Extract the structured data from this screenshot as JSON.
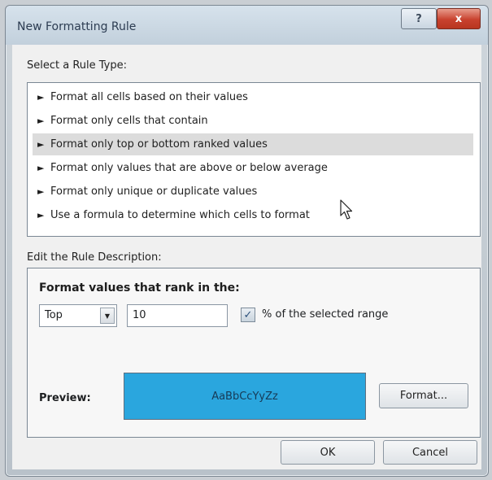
{
  "window": {
    "title": "New Formatting Rule",
    "help_label": "?",
    "close_label": "x"
  },
  "rule_type": {
    "label": "Select a Rule Type:",
    "selected_index": 2,
    "items": [
      "Format all cells based on their values",
      "Format only cells that contain",
      "Format only top or bottom ranked values",
      "Format only values that are above or below average",
      "Format only unique or duplicate values",
      "Use a formula to determine which cells to format"
    ]
  },
  "description": {
    "label": "Edit the Rule Description:",
    "heading": "Format values that rank in the:",
    "rank_select": "Top",
    "rank_count": "10",
    "percent_checked": true,
    "percent_label": "% of the selected range",
    "preview_label": "Preview:",
    "preview_text": "AaBbCcYyZz",
    "preview_color": "#2aa6de",
    "format_button": "Format..."
  },
  "buttons": {
    "ok": "OK",
    "cancel": "Cancel"
  }
}
